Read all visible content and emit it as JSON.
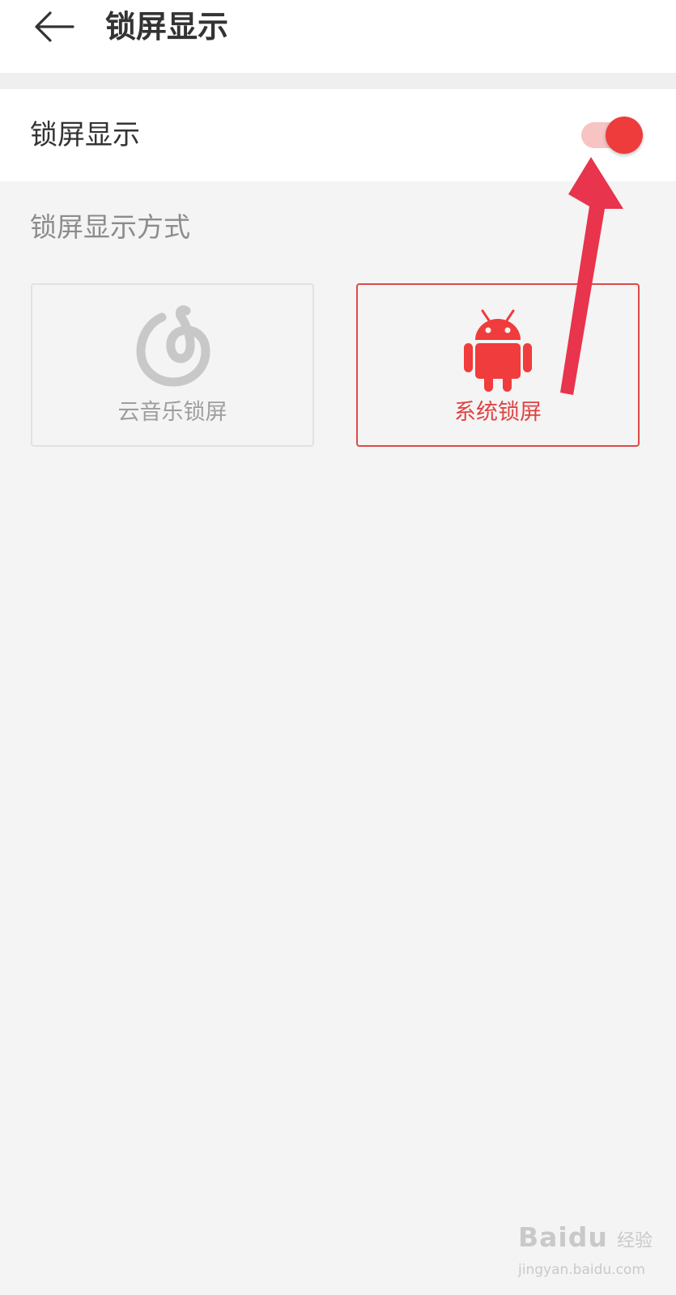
{
  "header": {
    "back_icon": "arrow-left-icon",
    "title": "锁屏显示"
  },
  "lock_toggle": {
    "label": "锁屏显示",
    "state": "on",
    "accent": "#ee3b3b"
  },
  "section": {
    "label": "锁屏显示方式"
  },
  "options": [
    {
      "label": "云音乐锁屏",
      "icon": "netease-cloud-music-icon",
      "selected": false
    },
    {
      "label": "系统锁屏",
      "icon": "android-icon",
      "selected": true
    }
  ],
  "watermark": {
    "brand": "Baidu",
    "sub": "经验",
    "url": "jingyan.baidu.com"
  }
}
